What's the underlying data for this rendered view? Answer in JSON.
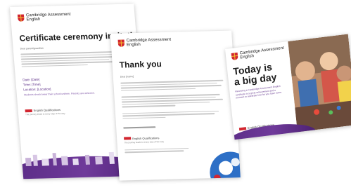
{
  "brand": {
    "line1": "Cambridge Assessment",
    "line2": "English"
  },
  "doc1": {
    "title": "Certificate ceremony invitation",
    "greeting": "Dear parent/guardian",
    "date_label": "Date: [Date]",
    "time_label": "Time: [Time]",
    "location_label": "Location: [Location]",
    "note": "Students should wear their school uniform. Parents are welcome.",
    "footer_brand": "English Qualifications",
    "footer_note": "The journey leads to every step of the way"
  },
  "doc2": {
    "title": "Thank you",
    "greeting": "Dear [name]",
    "footer_brand": "English Qualifications",
    "footer_note": "The journey leads to every step of the way"
  },
  "doc3": {
    "title_line1": "Today is",
    "title_line2": "a big day",
    "subtitle": "Receiving a Cambridge Assessment English certificate is a great achievement and a moment to celebrate how far you have come.",
    "footer_brand": "English Qualifications"
  },
  "colors": {
    "brand_red": "#d22630",
    "purple": "#5b2c86"
  }
}
